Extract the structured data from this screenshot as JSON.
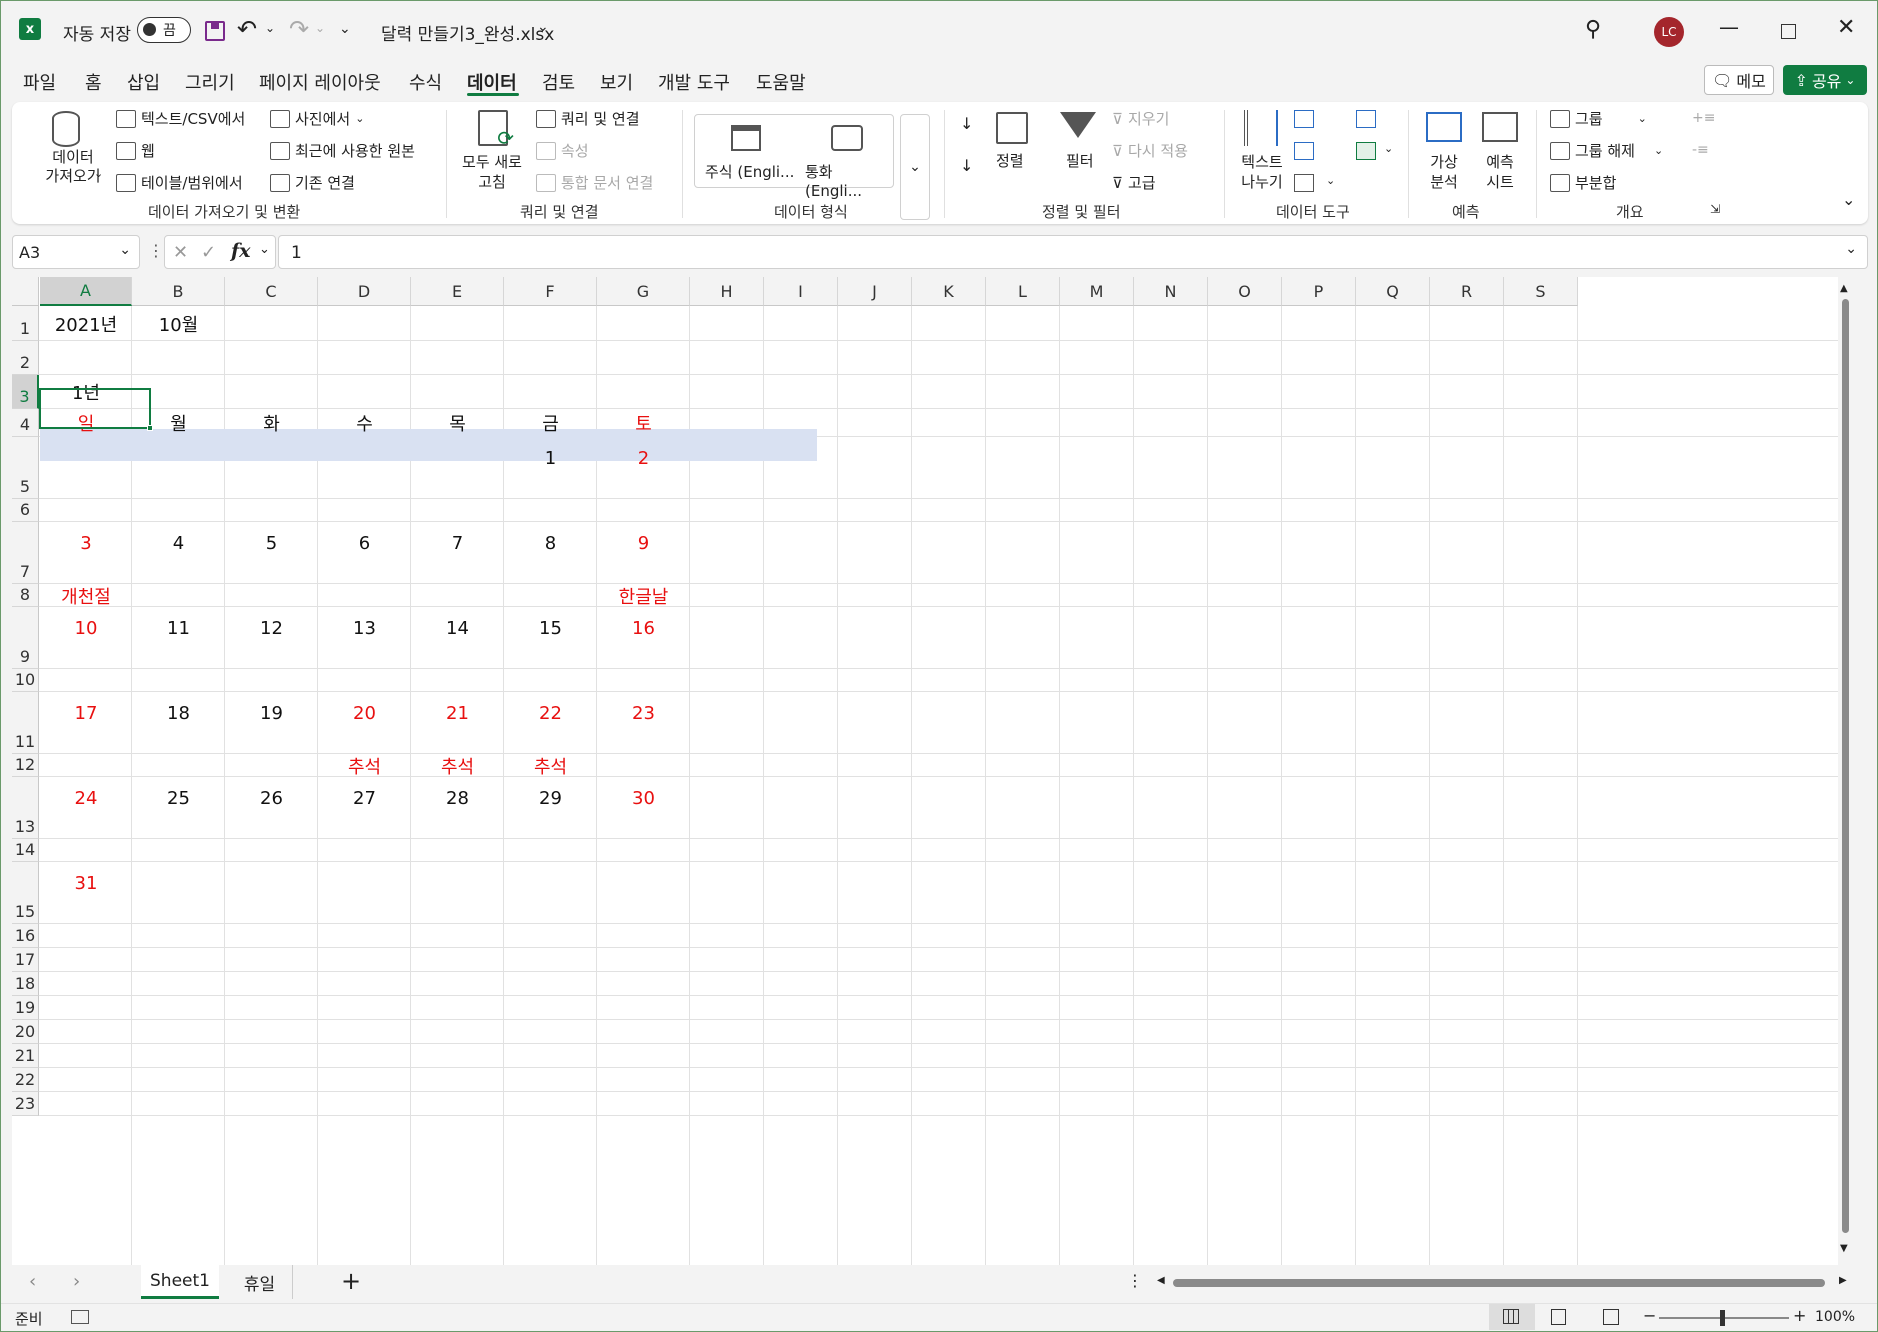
{
  "window": {
    "autosave_label": "자동 저장",
    "autosave_state": "끔",
    "filename": "달력 만들기3_완성.xlsx",
    "user_initials": "LC",
    "brand_color": "#107c41",
    "avatar_color": "#a4262c"
  },
  "tabs": [
    "파일",
    "홈",
    "삽입",
    "그리기",
    "페이지 레이아웃",
    "수식",
    "데이터",
    "검토",
    "보기",
    "개발 도구",
    "도움말"
  ],
  "active_tab": "데이터",
  "memo_label": "메모",
  "share_label": "공유",
  "ribbon": {
    "get_data": "데이터\n가져오기",
    "text_csv": "텍스트/CSV에서",
    "web": "웹",
    "table_range": "테이블/범위에서",
    "from_picture": "사진에서",
    "recent_sources": "최근에 사용한 원본",
    "existing_conn": "기존 연결",
    "group1": "데이터 가져오기 및 변환",
    "refresh_all": "모두 새로\n고침",
    "queries_conn": "쿼리 및 연결",
    "properties": "속성",
    "edit_links": "통합 문서 연결",
    "group2": "쿼리 및 연결",
    "stocks": "주식 (Engli...",
    "currencies": "통화 (Engli...",
    "group3": "데이터 형식",
    "sort": "정렬",
    "filter": "필터",
    "clear": "지우기",
    "reapply": "다시 적용",
    "advanced": "고급",
    "group4": "정렬 및 필터",
    "text_to_cols": "텍스트\n나누기",
    "group5": "데이터 도구",
    "what_if": "가상\n분석",
    "forecast_sheet": "예측\n시트",
    "group6": "예측",
    "group_btn": "그룹",
    "ungroup": "그룹 해제",
    "subtotal": "부분합",
    "group7": "개요"
  },
  "formula_bar": {
    "name_box": "A3",
    "formula": "1"
  },
  "columns": [
    "A",
    "B",
    "C",
    "D",
    "E",
    "F",
    "G",
    "H",
    "I",
    "J",
    "K",
    "L",
    "M",
    "N",
    "O",
    "P",
    "Q",
    "R",
    "S"
  ],
  "rows": [
    "1",
    "2",
    "3",
    "4",
    "5",
    "6",
    "7",
    "8",
    "9",
    "10",
    "11",
    "12",
    "13",
    "14",
    "15",
    "16",
    "17",
    "18",
    "19",
    "20",
    "21",
    "22",
    "23"
  ],
  "cells": {
    "a1": "2021년",
    "b1": "10월",
    "a3": "1년",
    "weekdays": [
      "일",
      "월",
      "화",
      "수",
      "목",
      "금",
      "토"
    ],
    "week1": [
      "",
      "",
      "",
      "",
      "",
      "1",
      "2"
    ],
    "week2": [
      "3",
      "4",
      "5",
      "6",
      "7",
      "8",
      "9"
    ],
    "week2_holidays": [
      "개천절",
      "",
      "",
      "",
      "",
      "",
      "한글날"
    ],
    "week3": [
      "10",
      "11",
      "12",
      "13",
      "14",
      "15",
      "16"
    ],
    "week4": [
      "17",
      "18",
      "19",
      "20",
      "21",
      "22",
      "23"
    ],
    "week4_holidays": [
      "",
      "",
      "",
      "추석",
      "추석",
      "추석",
      ""
    ],
    "week5": [
      "24",
      "25",
      "26",
      "27",
      "28",
      "29",
      "30"
    ],
    "week6": [
      "31",
      "",
      "",
      "",
      "",
      "",
      ""
    ]
  },
  "sheets": [
    "Sheet1",
    "휴일"
  ],
  "active_sheet": "Sheet1",
  "status": {
    "ready": "준비",
    "zoom": "100%"
  },
  "colors": {
    "holiday_red": "#e81010",
    "weekday_header_bg": "#d9e1f2",
    "selection_green": "#107c41"
  }
}
